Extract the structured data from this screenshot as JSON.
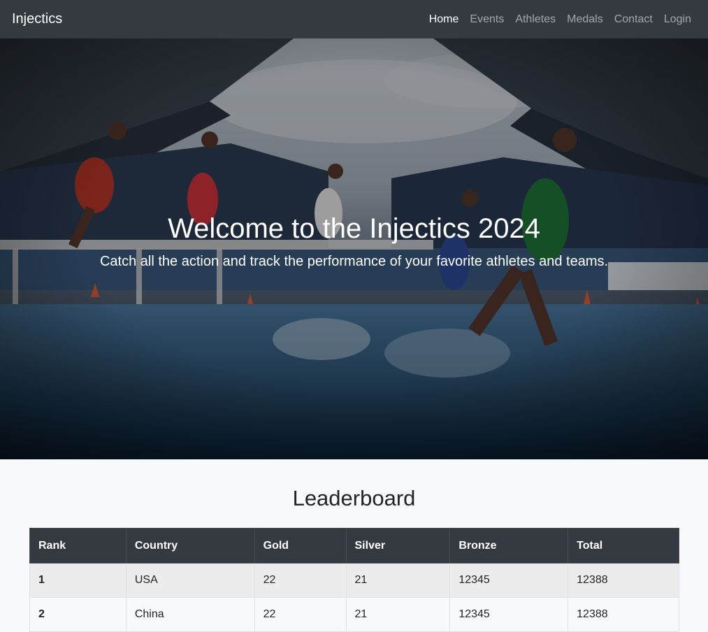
{
  "navbar": {
    "brand": "Injectics",
    "links": [
      {
        "label": "Home",
        "active": true
      },
      {
        "label": "Events",
        "active": false
      },
      {
        "label": "Athletes",
        "active": false
      },
      {
        "label": "Medals",
        "active": false
      },
      {
        "label": "Contact",
        "active": false
      },
      {
        "label": "Login",
        "active": false
      }
    ]
  },
  "hero": {
    "title": "Welcome to the Injectics 2024",
    "subtitle": "Catch all the action and track the performance of your favorite athletes and teams."
  },
  "leaderboard": {
    "title": "Leaderboard",
    "columns": [
      "Rank",
      "Country",
      "Gold",
      "Silver",
      "Bronze",
      "Total"
    ],
    "rows": [
      [
        "1",
        "USA",
        "22",
        "21",
        "12345",
        "12388"
      ],
      [
        "2",
        "China",
        "22",
        "21",
        "12345",
        "12388"
      ]
    ]
  },
  "colors": {
    "navbar_bg": "#343a40",
    "table_header_bg": "#343a40",
    "page_bg": "#f8f9fa"
  }
}
